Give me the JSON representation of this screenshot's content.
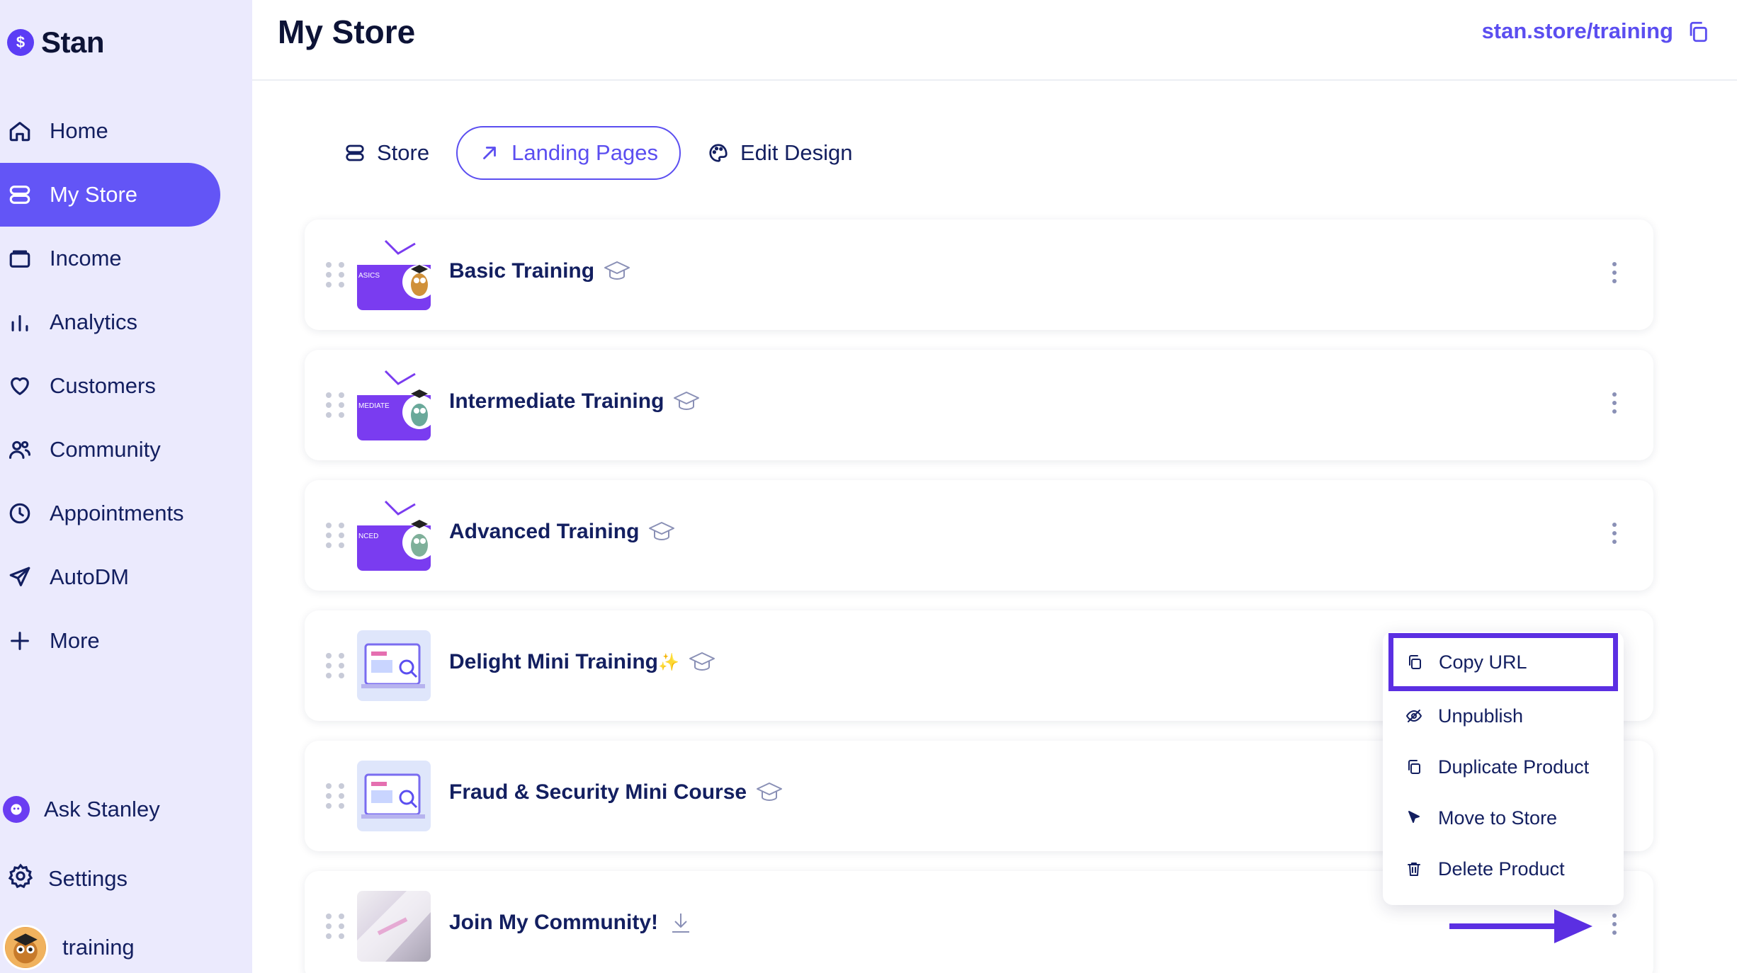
{
  "sidebar": {
    "brand": "Stan",
    "brand_icon": "$",
    "nav": [
      {
        "label": "Home",
        "icon": "home-icon"
      },
      {
        "label": "My Store",
        "icon": "store-icon",
        "active": true
      },
      {
        "label": "Income",
        "icon": "wallet-icon"
      },
      {
        "label": "Analytics",
        "icon": "bar-chart-icon"
      },
      {
        "label": "Customers",
        "icon": "heart-icon"
      },
      {
        "label": "Community",
        "icon": "users-icon"
      },
      {
        "label": "Appointments",
        "icon": "clock-icon"
      },
      {
        "label": "AutoDM",
        "icon": "send-icon"
      },
      {
        "label": "More",
        "icon": "plus-icon"
      }
    ],
    "ask_stanley": "Ask Stanley",
    "settings": "Settings",
    "user": "training"
  },
  "header": {
    "title": "My Store",
    "store_url": "stan.store/training"
  },
  "tabs": [
    {
      "label": "Store",
      "icon": "list-icon"
    },
    {
      "label": "Landing Pages",
      "icon": "arrow-up-right-icon",
      "active": true
    },
    {
      "label": "Edit Design",
      "icon": "palette-icon"
    }
  ],
  "products": [
    {
      "name": "Basic Training",
      "badge_icon": "graduation-cap-icon",
      "thumb_text": "ASICS"
    },
    {
      "name": "Intermediate Training",
      "badge_icon": "graduation-cap-icon",
      "thumb_text": "MEDIATE"
    },
    {
      "name": "Advanced Training",
      "badge_icon": "graduation-cap-icon",
      "thumb_text": "NCED"
    },
    {
      "name": "Delight Mini Training",
      "sparkle": "✨",
      "badge_icon": "graduation-cap-icon"
    },
    {
      "name": "Fraud & Security Mini Course",
      "badge_icon": "graduation-cap-icon"
    },
    {
      "name": "Join My Community!",
      "badge_icon": "download-icon"
    }
  ],
  "context_menu": [
    {
      "label": "Copy URL",
      "icon": "copy-icon",
      "highlighted": true
    },
    {
      "label": "Unpublish",
      "icon": "eye-off-icon"
    },
    {
      "label": "Duplicate Product",
      "icon": "duplicate-icon"
    },
    {
      "label": "Move to Store",
      "icon": "cursor-icon"
    },
    {
      "label": "Delete Product",
      "icon": "trash-icon"
    }
  ],
  "colors": {
    "accent": "#5b4ef0",
    "sidebar_bg": "#ebeafd",
    "active_nav": "#6355f6",
    "text": "#131f60",
    "highlight_border": "#5b2fe2"
  }
}
